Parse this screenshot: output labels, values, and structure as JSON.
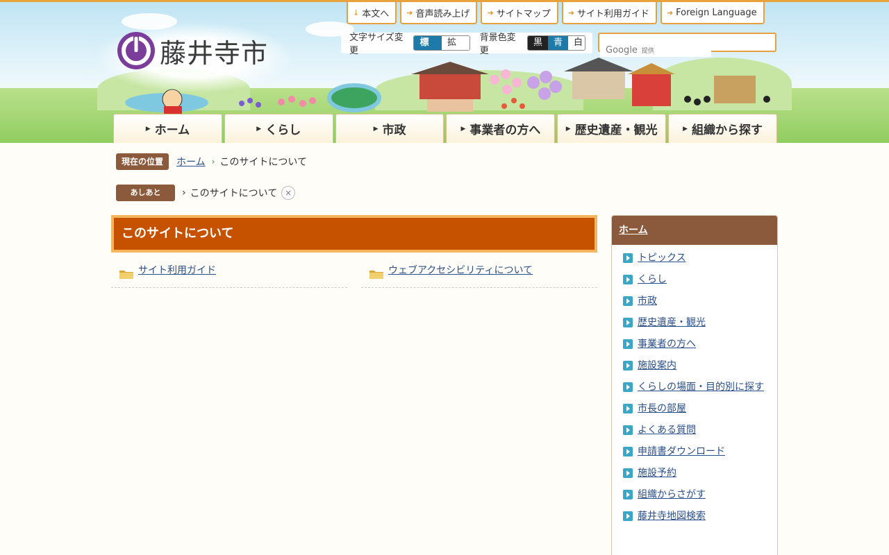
{
  "logo": {
    "text": "藤井寺市"
  },
  "top_links": [
    {
      "label": "本文へ"
    },
    {
      "label": "音声読み上げ"
    },
    {
      "label": "サイトマップ"
    },
    {
      "label": "サイト利用ガイド"
    },
    {
      "label": "Foreign Language"
    }
  ],
  "text_size": {
    "label": "文字サイズ変更",
    "standard": "標準",
    "large": "拡大"
  },
  "bg_color": {
    "label": "背景色変更",
    "black": "黒",
    "blue": "青",
    "white": "白"
  },
  "search": {
    "placeholder": "",
    "google_text": "Google",
    "provided": "提供"
  },
  "global_nav": [
    {
      "label": "ホーム"
    },
    {
      "label": "くらし"
    },
    {
      "label": "市政"
    },
    {
      "label": "事業者の方へ"
    },
    {
      "label": "歴史遺産・観光"
    },
    {
      "label": "組織から探す"
    }
  ],
  "breadcrumb": {
    "tag": "現在の位置",
    "home": "ホーム",
    "current": "このサイトについて"
  },
  "footprints": {
    "tag": "あしあと",
    "current": "このサイトについて",
    "close_glyph": "×"
  },
  "main": {
    "title": "このサイトについて",
    "links": [
      {
        "label": "サイト利用ガイド"
      },
      {
        "label": "ウェブアクセシビリティについて"
      }
    ]
  },
  "side": {
    "title": "ホーム",
    "items": [
      "トピックス",
      "くらし",
      "市政",
      "歴史遺産・観光",
      "事業者の方へ",
      "施設案内",
      "くらしの場面・目的別に探す",
      "市長の部屋",
      "よくある質問",
      "申請書ダウンロード",
      "施設予約",
      "組織からさがす",
      "藤井寺地図検索"
    ]
  },
  "colors": {
    "accent_orange": "#e5a040",
    "title_bg": "#c65200",
    "brown_tag": "#8b5a3c",
    "blue_active": "#1e7aa8",
    "logo_purple": "#7a3d9a"
  }
}
